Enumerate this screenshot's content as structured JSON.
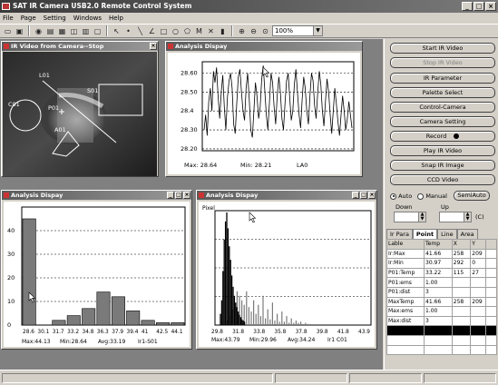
{
  "app": {
    "title": "SAT IR Camera USB2.0 Remote Control System"
  },
  "menu": [
    "File",
    "Page",
    "Setting",
    "Windows",
    "Help"
  ],
  "toolbar": {
    "combo_value": "100%"
  },
  "ir_window": {
    "title": "IR Video from Camera--Stop",
    "labels": {
      "c01": "C01",
      "l01": "L01",
      "s01": "S01",
      "p01": "P01",
      "a01": "A01"
    }
  },
  "analysis_top": {
    "title": "Analysis Dispay",
    "footer": {
      "max": "Max: 28.64",
      "min": "Min: 28.21",
      "id": "LA0"
    },
    "chart_data": {
      "type": "line",
      "yticks": [
        "28.60",
        "28.50",
        "28.4",
        "28.30",
        "28.20"
      ],
      "ylim": [
        28.19,
        28.66
      ],
      "series": [
        {
          "values": [
            28.3,
            28.38,
            28.27,
            28.45,
            28.52,
            28.4,
            28.61,
            28.55,
            28.63,
            28.48,
            28.36,
            28.5,
            28.59,
            28.42,
            28.3,
            28.47,
            28.56,
            28.6,
            28.52,
            28.33,
            28.28,
            28.44,
            28.58,
            28.62,
            28.5,
            28.4,
            28.35,
            28.52,
            28.6,
            28.46,
            28.3,
            28.26,
            28.4,
            28.55,
            28.48,
            28.36,
            28.42,
            28.57,
            28.64,
            28.51,
            28.38,
            28.3,
            28.45,
            28.6,
            28.55,
            28.42,
            28.33,
            28.48,
            28.58,
            28.5,
            28.36,
            28.3,
            28.44,
            28.56,
            28.6,
            28.47,
            28.35,
            28.4,
            28.54,
            28.62,
            28.5,
            28.38,
            28.31,
            28.46,
            28.58,
            28.52,
            28.4,
            28.33,
            28.48,
            28.6,
            28.56,
            28.43,
            28.36,
            28.5,
            28.61,
            28.54,
            28.4,
            28.32,
            28.45,
            28.57,
            28.5,
            28.38,
            28.28,
            28.4,
            28.52,
            28.44,
            28.34,
            28.27,
            28.38,
            28.48,
            28.4,
            28.3,
            28.36,
            28.45,
            28.38,
            28.31
          ]
        }
      ]
    }
  },
  "analysis_left": {
    "title": "Analysis Dispay",
    "footer": {
      "max": "Max:44.13",
      "min": "Min:28.64",
      "avg": "Avg:33.19",
      "id": "Ir1-S01"
    },
    "chart_data": {
      "type": "bar",
      "categories": [
        "28.6",
        "30.1",
        "31.7",
        "33.2",
        "34.8",
        "36.3",
        "37.9",
        "39.4",
        "41",
        "42.5",
        "44.1"
      ],
      "values": [
        45,
        0,
        2,
        4,
        7,
        14,
        12,
        6,
        2,
        1,
        1
      ],
      "yticks": [
        "40",
        "30",
        "20",
        "10",
        "0"
      ],
      "ylim": [
        0,
        50
      ]
    }
  },
  "analysis_right": {
    "title": "Analysis Dispay",
    "ylabel": "Pixel",
    "footer": {
      "max": "Max:43.79",
      "min": "Min:29.96",
      "avg": "Avg:34.24",
      "id": "Ir1 C01"
    },
    "chart_data": {
      "type": "histogram",
      "xticks": [
        "29.8",
        "31.8",
        "33.8",
        "35.8",
        "37.8",
        "39.8",
        "41.8",
        "43.9"
      ],
      "series": [
        {
          "name": "",
          "color": "#000000",
          "values": [
            10,
            22,
            48,
            76,
            92,
            100,
            86,
            70,
            58,
            44,
            34,
            26,
            20,
            16,
            12,
            9,
            7,
            5,
            4,
            3
          ]
        },
        {
          "name": "",
          "color": "#7a7a7a",
          "values": [
            4,
            8,
            14,
            20,
            30,
            26,
            22,
            18,
            30,
            16,
            12,
            22,
            10,
            18,
            8,
            26,
            6,
            14,
            5,
            20,
            4,
            10,
            3,
            12,
            3,
            8,
            2,
            6,
            2,
            4,
            2,
            3,
            1,
            2,
            1,
            1
          ]
        }
      ]
    }
  },
  "buttons": {
    "start_ir_video": "Start IR Video",
    "stop_ir_video": "Stop IR Video",
    "ir_parameter": "IR Parameter",
    "palette_select": "Palette Select",
    "control_camera": "Control-Camera",
    "camera_setting": "Camera Setting",
    "record": "Record",
    "play_ir_video": "Play IR Video",
    "snap_ir_image": "Snap IR Image",
    "ccd_video": "CCD Video",
    "semi_auto": "SemiAuto"
  },
  "range": {
    "auto": "Auto",
    "manual": "Manual",
    "down": "Down",
    "up": "Up",
    "unit": "(C)"
  },
  "tabs": [
    "Ir Para",
    "Point",
    "Line",
    "Area"
  ],
  "table": {
    "headers": [
      "Lable",
      "Temp",
      "X",
      "Y"
    ],
    "rows": [
      [
        "Ir:Max",
        "41.66",
        "258",
        "209"
      ],
      [
        "Ir:Min",
        "30.97",
        "292",
        "0"
      ],
      [
        "P01:Temp",
        "33.22",
        "115",
        "27"
      ],
      [
        "P01:ems",
        "1.00",
        "",
        ""
      ],
      [
        "P01:dist",
        "3",
        "",
        ""
      ],
      [
        "MaxTemp",
        "41.66",
        "258",
        "209"
      ],
      [
        "Max:ems",
        "1.00",
        "",
        ""
      ],
      [
        "Max:dist",
        "3",
        "",
        ""
      ],
      [
        "",
        "",
        "",
        ""
      ],
      [
        "",
        "",
        "",
        ""
      ],
      [
        "",
        "",
        "",
        ""
      ]
    ]
  }
}
